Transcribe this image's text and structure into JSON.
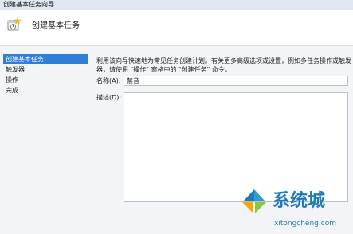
{
  "window": {
    "title": "创建基本任务向导"
  },
  "header": {
    "title": "创建基本任务"
  },
  "sidebar": {
    "items": [
      {
        "label": "创建基本任务",
        "selected": true
      },
      {
        "label": "触发器",
        "selected": false
      },
      {
        "label": "操作",
        "selected": false
      },
      {
        "label": "完成",
        "selected": false
      }
    ]
  },
  "main": {
    "description": "利用该向导快速地为常见任务创建计划。有关更多高级选项或设置，例如多任务操作或触发器，请使用 \"操作\" 窗格中的 \"创建任务\" 命令。",
    "name_label": "名称(A):",
    "name_value": "禁音",
    "description_label": "描述(D):",
    "description_value": ""
  },
  "watermark": {
    "brand": "系统城",
    "url": "xitongcheng.com"
  },
  "colors": {
    "selection": "#2f7ed8",
    "titlebar": "#dfe7f1",
    "panel": "#f2f4f7",
    "watermark": "#1f7ab8"
  }
}
